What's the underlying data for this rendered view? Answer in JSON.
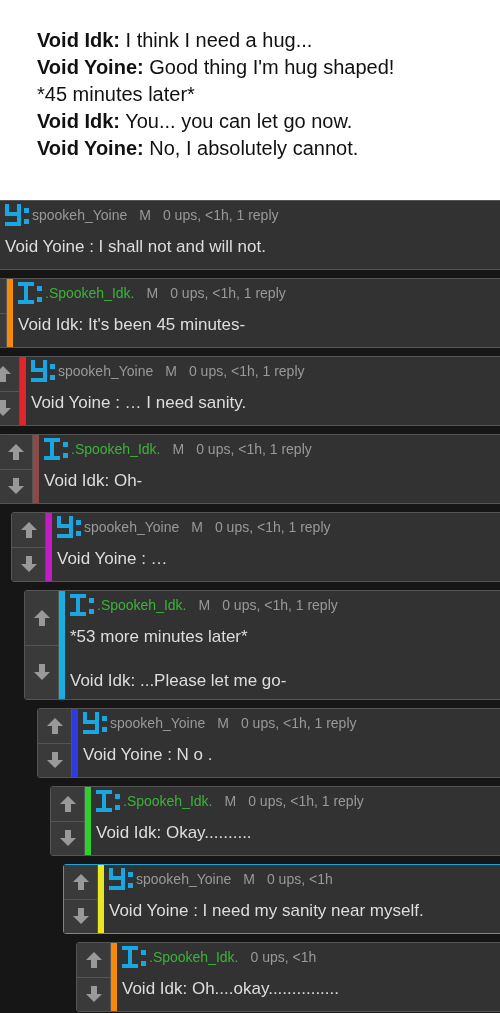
{
  "caption": {
    "lines": [
      {
        "speaker": "Void Idk:",
        "text": "I think I need a hug..."
      },
      {
        "speaker": "Void Yoine:",
        "text": "Good thing I'm hug shaped!"
      },
      {
        "text": "*45 minutes later*"
      },
      {
        "speaker": "Void Idk:",
        "text": "You... you can let go now."
      },
      {
        "speaker": "Void Yoine:",
        "text": "No, I absolutely cannot."
      }
    ]
  },
  "comments": [
    {
      "avatar": {
        "kind": "y"
      },
      "user": {
        "name": "spookeh_Yoine",
        "kind": "plain"
      },
      "mod": "M",
      "stats": "0 ups, <1h, 1 reply",
      "body": [
        "Void Yoine : I shall not and will not."
      ],
      "highlighted": false
    },
    {
      "avatar": {
        "kind": "i"
      },
      "user": {
        "name": ".Spookeh_Idk.",
        "kind": "green"
      },
      "mod": "M",
      "stats": "0 ups, <1h, 1 reply",
      "body": [
        "Void Idk: It's been 45 minutes-"
      ],
      "color": "#f5890a",
      "highlighted": false
    },
    {
      "avatar": {
        "kind": "y"
      },
      "user": {
        "name": "spookeh_Yoine",
        "kind": "plain"
      },
      "mod": "M",
      "stats": "0 ups, <1h, 1 reply",
      "body": [
        "Void Yoine : … I need sanity."
      ],
      "color": "#e0262a",
      "highlighted": false
    },
    {
      "avatar": {
        "kind": "i"
      },
      "user": {
        "name": ".Spookeh_Idk.",
        "kind": "green"
      },
      "mod": "M",
      "stats": "0 ups, <1h, 1 reply",
      "body": [
        "Void Idk: Oh-"
      ],
      "color": "#8a4a48",
      "highlighted": false
    },
    {
      "avatar": {
        "kind": "y"
      },
      "user": {
        "name": "spookeh_Yoine",
        "kind": "plain"
      },
      "mod": "M",
      "stats": "0 ups, <1h, 1 reply",
      "body": [
        "Void Yoine : …"
      ],
      "color": "#c21cc2",
      "highlighted": false
    },
    {
      "avatar": {
        "kind": "i"
      },
      "user": {
        "name": ".Spookeh_Idk.",
        "kind": "green"
      },
      "mod": "M",
      "stats": "0 ups, <1h, 1 reply",
      "body": [
        "*53 more minutes later*",
        "Void Idk: ...Please let me go-"
      ],
      "color": "#19aee0",
      "highlighted": false
    },
    {
      "avatar": {
        "kind": "y"
      },
      "user": {
        "name": "spookeh_Yoine",
        "kind": "plain"
      },
      "mod": "M",
      "stats": "0 ups, <1h, 1 reply",
      "body": [
        "Void Yoine : N o ."
      ],
      "color": "#3038e0",
      "highlighted": false
    },
    {
      "avatar": {
        "kind": "i"
      },
      "user": {
        "name": ".Spookeh_Idk.",
        "kind": "green"
      },
      "mod": "M",
      "stats": "0 ups, <1h, 1 reply",
      "body": [
        "Void Idk: Okay.........."
      ],
      "color": "#2ed02e",
      "highlighted": false
    },
    {
      "avatar": {
        "kind": "y"
      },
      "user": {
        "name": "spookeh_Yoine",
        "kind": "plain"
      },
      "mod": "M",
      "stats": "0 ups, <1h",
      "body": [
        "Void Yoine : I need my sanity near myself."
      ],
      "color": "#e8e820",
      "highlighted": true
    },
    {
      "avatar": {
        "kind": "i"
      },
      "user": {
        "name": ".Spookeh_Idk.",
        "kind": "green"
      },
      "stats": "0 ups, <1h",
      "body": [
        "Void Idk: Oh....okay..............."
      ],
      "color": "#f5890a",
      "highlighted": false
    }
  ]
}
